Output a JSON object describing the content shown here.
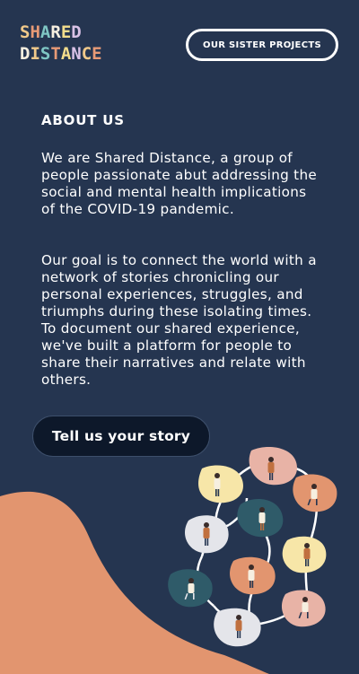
{
  "header": {
    "logo_line1": "SHARED",
    "logo_line2": "DISTANCE",
    "logo_line1_letters": [
      "S",
      "H",
      "A",
      "R",
      "E",
      "D"
    ],
    "logo_line2_letters": [
      "D",
      "I",
      "S",
      "T",
      "A",
      "N",
      "C",
      "E"
    ],
    "logo_colors": [
      "#f0c98a",
      "#e89a76",
      "#7fc6c4",
      "#f6efe0",
      "#f3dd8c",
      "#d9c2e6"
    ],
    "sister_projects_label": "OUR SISTER PROJECTS"
  },
  "about": {
    "heading": "ABOUT US",
    "paragraph1": "We are Shared Distance, a group of people passionate abut addressing the social and mental health implications of the COVID-19 pandemic.",
    "paragraph2": "Our goal is to connect the world with a network of stories chronicling our personal experiences, struggles, and triumphs during these isolating times. To document our shared experience, we've built a platform for people to share their narratives and relate with others."
  },
  "cta": {
    "label": "Tell us your story"
  },
  "colors": {
    "background": "#253550",
    "button_dark": "#0d182a",
    "wave": "#e2956f",
    "blob_yellow": "#f7e6a8",
    "blob_pink": "#e8b3a6",
    "blob_orange": "#e2956f",
    "blob_teal": "#2f5b69",
    "blob_grey": "#e4e5ea"
  },
  "illustration": {
    "name": "people-network-illustration",
    "blob_colors": [
      "yellow",
      "pink",
      "orange",
      "teal",
      "grey",
      "yellow",
      "teal",
      "orange",
      "pink",
      "grey"
    ]
  }
}
